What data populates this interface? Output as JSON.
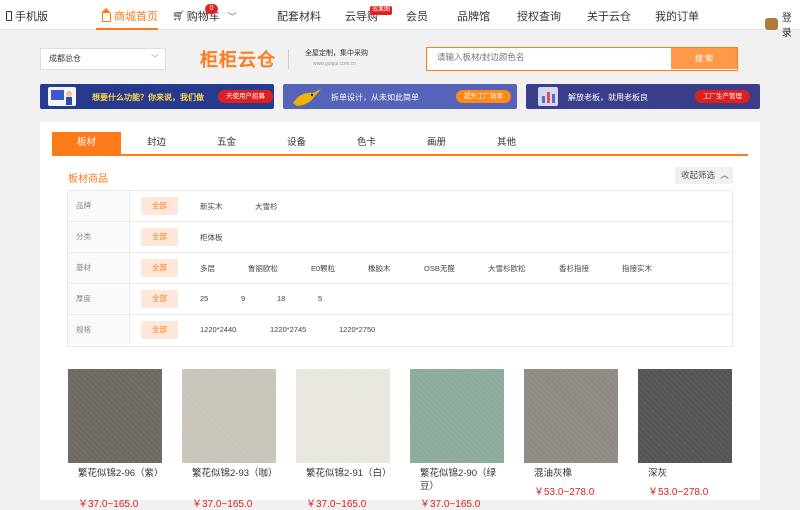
{
  "topnav": {
    "mobile": "手机版",
    "items": [
      "商城首页",
      "购物车",
      "配套材料",
      "云导购",
      "会员",
      "品牌馆",
      "授权查询",
      "关于云仓",
      "我的订单"
    ],
    "cart_count": "0",
    "guide_badge": "效果图",
    "user": "登录"
  },
  "header": {
    "city": "成都总仓",
    "logo": "柜柜云仓",
    "slogan": "全屋定制，集中采购",
    "slogan_url": "www.guigui.com.cn",
    "search_placeholder": "请输入板材/封边颜色名",
    "search_button": "搜 索"
  },
  "banners": [
    {
      "text": "想要什么功能？你来说，我们做",
      "button": "天使用户招募"
    },
    {
      "text": "拆单设计，从未如此简单",
      "button": "提升工厂效率"
    },
    {
      "text": "解放老板，就用老板良",
      "button": "工厂生产管理"
    }
  ],
  "tabs": [
    "板材",
    "封边",
    "五金",
    "设备",
    "色卡",
    "画册",
    "其他"
  ],
  "section": {
    "title": "板材商品",
    "collapse": "收起筛选"
  },
  "filters": [
    {
      "label": "品牌",
      "all": "全部",
      "options": [
        "新实木",
        "大雪杉"
      ]
    },
    {
      "label": "分类",
      "all": "全部",
      "options": [
        "柜体板"
      ]
    },
    {
      "label": "基材",
      "all": "全部",
      "options": [
        "多层",
        "鲁丽欧松",
        "E0颗粒",
        "橡胶木",
        "OSB无醛",
        "大雪杉欧松",
        "香杉指接",
        "指接实木"
      ]
    },
    {
      "label": "厚度",
      "all": "全部",
      "options": [
        "25",
        "9",
        "18",
        "5"
      ]
    },
    {
      "label": "规格",
      "all": "全部",
      "options": [
        "1220*2440",
        "1220*2745",
        "1220*2750"
      ]
    }
  ],
  "products": [
    {
      "name": "繁花似锦2-96（紫）",
      "price": "￥37.0~165.0",
      "color": "#6e6a63"
    },
    {
      "name": "繁花似锦2-93（咖）",
      "price": "￥37.0~165.0",
      "color": "#c9c5bb"
    },
    {
      "name": "繁花似锦2-91（白）",
      "price": "￥37.0~165.0",
      "color": "#e9e7e0"
    },
    {
      "name": "繁花似锦2-90（绿豆）",
      "price": "￥37.0~165.0",
      "color": "#8cab9d"
    },
    {
      "name": "混油灰橡",
      "price": "￥53.0~278.0",
      "color": "#8f8a84"
    },
    {
      "name": "深灰",
      "price": "￥53.0~278.0",
      "color": "#555553"
    }
  ]
}
